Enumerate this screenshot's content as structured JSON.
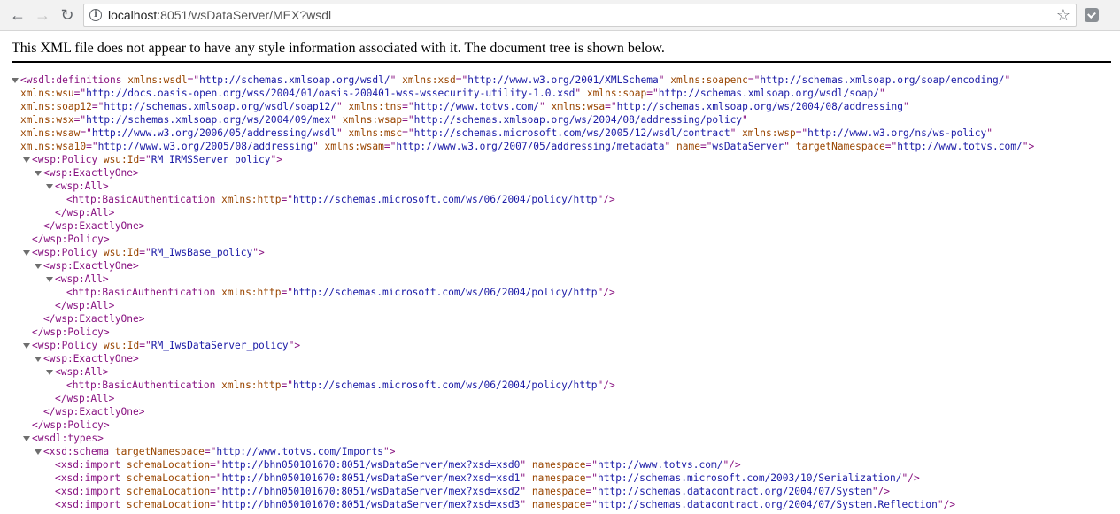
{
  "browser": {
    "url_host": "localhost",
    "url_rest": ":8051/wsDataServer/MEX?wsdl"
  },
  "info_banner": "This XML file does not appear to have any style information associated with it. The document tree is shown below.",
  "xml_lines": [
    {
      "indent": 0,
      "toggle": true,
      "parts": [
        [
          "t",
          "<wsdl:definitions "
        ],
        [
          "a",
          "xmlns:wsdl"
        ],
        [
          "t",
          "=\""
        ],
        [
          "v",
          "http://schemas.xmlsoap.org/wsdl/"
        ],
        [
          "t",
          "\" "
        ],
        [
          "a",
          "xmlns:xsd"
        ],
        [
          "t",
          "=\""
        ],
        [
          "v",
          "http://www.w3.org/2001/XMLSchema"
        ],
        [
          "t",
          "\" "
        ],
        [
          "a",
          "xmlns:soapenc"
        ],
        [
          "t",
          "=\""
        ],
        [
          "v",
          "http://schemas.xmlsoap.org/soap/encoding/"
        ],
        [
          "t",
          "\""
        ]
      ]
    },
    {
      "indent": 0,
      "toggle": false,
      "parts": [
        [
          "a",
          "xmlns:wsu"
        ],
        [
          "t",
          "=\""
        ],
        [
          "v",
          "http://docs.oasis-open.org/wss/2004/01/oasis-200401-wss-wssecurity-utility-1.0.xsd"
        ],
        [
          "t",
          "\" "
        ],
        [
          "a",
          "xmlns:soap"
        ],
        [
          "t",
          "=\""
        ],
        [
          "v",
          "http://schemas.xmlsoap.org/wsdl/soap/"
        ],
        [
          "t",
          "\""
        ]
      ]
    },
    {
      "indent": 0,
      "toggle": false,
      "parts": [
        [
          "a",
          "xmlns:soap12"
        ],
        [
          "t",
          "=\""
        ],
        [
          "v",
          "http://schemas.xmlsoap.org/wsdl/soap12/"
        ],
        [
          "t",
          "\" "
        ],
        [
          "a",
          "xmlns:tns"
        ],
        [
          "t",
          "=\""
        ],
        [
          "v",
          "http://www.totvs.com/"
        ],
        [
          "t",
          "\" "
        ],
        [
          "a",
          "xmlns:wsa"
        ],
        [
          "t",
          "=\""
        ],
        [
          "v",
          "http://schemas.xmlsoap.org/ws/2004/08/addressing"
        ],
        [
          "t",
          "\""
        ]
      ]
    },
    {
      "indent": 0,
      "toggle": false,
      "parts": [
        [
          "a",
          "xmlns:wsx"
        ],
        [
          "t",
          "=\""
        ],
        [
          "v",
          "http://schemas.xmlsoap.org/ws/2004/09/mex"
        ],
        [
          "t",
          "\" "
        ],
        [
          "a",
          "xmlns:wsap"
        ],
        [
          "t",
          "=\""
        ],
        [
          "v",
          "http://schemas.xmlsoap.org/ws/2004/08/addressing/policy"
        ],
        [
          "t",
          "\""
        ]
      ]
    },
    {
      "indent": 0,
      "toggle": false,
      "parts": [
        [
          "a",
          "xmlns:wsaw"
        ],
        [
          "t",
          "=\""
        ],
        [
          "v",
          "http://www.w3.org/2006/05/addressing/wsdl"
        ],
        [
          "t",
          "\" "
        ],
        [
          "a",
          "xmlns:msc"
        ],
        [
          "t",
          "=\""
        ],
        [
          "v",
          "http://schemas.microsoft.com/ws/2005/12/wsdl/contract"
        ],
        [
          "t",
          "\" "
        ],
        [
          "a",
          "xmlns:wsp"
        ],
        [
          "t",
          "=\""
        ],
        [
          "v",
          "http://www.w3.org/ns/ws-policy"
        ],
        [
          "t",
          "\""
        ]
      ]
    },
    {
      "indent": 0,
      "toggle": false,
      "parts": [
        [
          "a",
          "xmlns:wsa10"
        ],
        [
          "t",
          "=\""
        ],
        [
          "v",
          "http://www.w3.org/2005/08/addressing"
        ],
        [
          "t",
          "\" "
        ],
        [
          "a",
          "xmlns:wsam"
        ],
        [
          "t",
          "=\""
        ],
        [
          "v",
          "http://www.w3.org/2007/05/addressing/metadata"
        ],
        [
          "t",
          "\" "
        ],
        [
          "a",
          "name"
        ],
        [
          "t",
          "=\""
        ],
        [
          "v",
          "wsDataServer"
        ],
        [
          "t",
          "\" "
        ],
        [
          "a",
          "targetNamespace"
        ],
        [
          "t",
          "=\""
        ],
        [
          "v",
          "http://www.totvs.com/"
        ],
        [
          "t",
          "\">"
        ]
      ]
    },
    {
      "indent": 1,
      "toggle": true,
      "parts": [
        [
          "t",
          "<wsp:Policy "
        ],
        [
          "a",
          "wsu:Id"
        ],
        [
          "t",
          "=\""
        ],
        [
          "v",
          "RM_IRMSServer_policy"
        ],
        [
          "t",
          "\">"
        ]
      ]
    },
    {
      "indent": 2,
      "toggle": true,
      "parts": [
        [
          "t",
          "<wsp:ExactlyOne>"
        ]
      ]
    },
    {
      "indent": 3,
      "toggle": true,
      "parts": [
        [
          "t",
          "<wsp:All>"
        ]
      ]
    },
    {
      "indent": 4,
      "toggle": false,
      "parts": [
        [
          "t",
          "<http:BasicAuthentication "
        ],
        [
          "a",
          "xmlns:http"
        ],
        [
          "t",
          "=\""
        ],
        [
          "v",
          "http://schemas.microsoft.com/ws/06/2004/policy/http"
        ],
        [
          "t",
          "\"/>"
        ]
      ]
    },
    {
      "indent": 3,
      "toggle": false,
      "parts": [
        [
          "t",
          "</wsp:All>"
        ]
      ]
    },
    {
      "indent": 2,
      "toggle": false,
      "parts": [
        [
          "t",
          "</wsp:ExactlyOne>"
        ]
      ]
    },
    {
      "indent": 1,
      "toggle": false,
      "parts": [
        [
          "t",
          "</wsp:Policy>"
        ]
      ]
    },
    {
      "indent": 1,
      "toggle": true,
      "parts": [
        [
          "t",
          "<wsp:Policy "
        ],
        [
          "a",
          "wsu:Id"
        ],
        [
          "t",
          "=\""
        ],
        [
          "v",
          "RM_IwsBase_policy"
        ],
        [
          "t",
          "\">"
        ]
      ]
    },
    {
      "indent": 2,
      "toggle": true,
      "parts": [
        [
          "t",
          "<wsp:ExactlyOne>"
        ]
      ]
    },
    {
      "indent": 3,
      "toggle": true,
      "parts": [
        [
          "t",
          "<wsp:All>"
        ]
      ]
    },
    {
      "indent": 4,
      "toggle": false,
      "parts": [
        [
          "t",
          "<http:BasicAuthentication "
        ],
        [
          "a",
          "xmlns:http"
        ],
        [
          "t",
          "=\""
        ],
        [
          "v",
          "http://schemas.microsoft.com/ws/06/2004/policy/http"
        ],
        [
          "t",
          "\"/>"
        ]
      ]
    },
    {
      "indent": 3,
      "toggle": false,
      "parts": [
        [
          "t",
          "</wsp:All>"
        ]
      ]
    },
    {
      "indent": 2,
      "toggle": false,
      "parts": [
        [
          "t",
          "</wsp:ExactlyOne>"
        ]
      ]
    },
    {
      "indent": 1,
      "toggle": false,
      "parts": [
        [
          "t",
          "</wsp:Policy>"
        ]
      ]
    },
    {
      "indent": 1,
      "toggle": true,
      "parts": [
        [
          "t",
          "<wsp:Policy "
        ],
        [
          "a",
          "wsu:Id"
        ],
        [
          "t",
          "=\""
        ],
        [
          "v",
          "RM_IwsDataServer_policy"
        ],
        [
          "t",
          "\">"
        ]
      ]
    },
    {
      "indent": 2,
      "toggle": true,
      "parts": [
        [
          "t",
          "<wsp:ExactlyOne>"
        ]
      ]
    },
    {
      "indent": 3,
      "toggle": true,
      "parts": [
        [
          "t",
          "<wsp:All>"
        ]
      ]
    },
    {
      "indent": 4,
      "toggle": false,
      "parts": [
        [
          "t",
          "<http:BasicAuthentication "
        ],
        [
          "a",
          "xmlns:http"
        ],
        [
          "t",
          "=\""
        ],
        [
          "v",
          "http://schemas.microsoft.com/ws/06/2004/policy/http"
        ],
        [
          "t",
          "\"/>"
        ]
      ]
    },
    {
      "indent": 3,
      "toggle": false,
      "parts": [
        [
          "t",
          "</wsp:All>"
        ]
      ]
    },
    {
      "indent": 2,
      "toggle": false,
      "parts": [
        [
          "t",
          "</wsp:ExactlyOne>"
        ]
      ]
    },
    {
      "indent": 1,
      "toggle": false,
      "parts": [
        [
          "t",
          "</wsp:Policy>"
        ]
      ]
    },
    {
      "indent": 1,
      "toggle": true,
      "parts": [
        [
          "t",
          "<wsdl:types>"
        ]
      ]
    },
    {
      "indent": 2,
      "toggle": true,
      "parts": [
        [
          "t",
          "<xsd:schema "
        ],
        [
          "a",
          "targetNamespace"
        ],
        [
          "t",
          "=\""
        ],
        [
          "v",
          "http://www.totvs.com/Imports"
        ],
        [
          "t",
          "\">"
        ]
      ]
    },
    {
      "indent": 3,
      "toggle": false,
      "parts": [
        [
          "t",
          "<xsd:import "
        ],
        [
          "a",
          "schemaLocation"
        ],
        [
          "t",
          "=\""
        ],
        [
          "v",
          "http://bhn050101670:8051/wsDataServer/mex?xsd=xsd0"
        ],
        [
          "t",
          "\" "
        ],
        [
          "a",
          "namespace"
        ],
        [
          "t",
          "=\""
        ],
        [
          "v",
          "http://www.totvs.com/"
        ],
        [
          "t",
          "\"/>"
        ]
      ]
    },
    {
      "indent": 3,
      "toggle": false,
      "parts": [
        [
          "t",
          "<xsd:import "
        ],
        [
          "a",
          "schemaLocation"
        ],
        [
          "t",
          "=\""
        ],
        [
          "v",
          "http://bhn050101670:8051/wsDataServer/mex?xsd=xsd1"
        ],
        [
          "t",
          "\" "
        ],
        [
          "a",
          "namespace"
        ],
        [
          "t",
          "=\""
        ],
        [
          "v",
          "http://schemas.microsoft.com/2003/10/Serialization/"
        ],
        [
          "t",
          "\"/>"
        ]
      ]
    },
    {
      "indent": 3,
      "toggle": false,
      "parts": [
        [
          "t",
          "<xsd:import "
        ],
        [
          "a",
          "schemaLocation"
        ],
        [
          "t",
          "=\""
        ],
        [
          "v",
          "http://bhn050101670:8051/wsDataServer/mex?xsd=xsd2"
        ],
        [
          "t",
          "\" "
        ],
        [
          "a",
          "namespace"
        ],
        [
          "t",
          "=\""
        ],
        [
          "v",
          "http://schemas.datacontract.org/2004/07/System"
        ],
        [
          "t",
          "\"/>"
        ]
      ]
    },
    {
      "indent": 3,
      "toggle": false,
      "parts": [
        [
          "t",
          "<xsd:import "
        ],
        [
          "a",
          "schemaLocation"
        ],
        [
          "t",
          "=\""
        ],
        [
          "v",
          "http://bhn050101670:8051/wsDataServer/mex?xsd=xsd3"
        ],
        [
          "t",
          "\" "
        ],
        [
          "a",
          "namespace"
        ],
        [
          "t",
          "=\""
        ],
        [
          "v",
          "http://schemas.datacontract.org/2004/07/System.Reflection"
        ],
        [
          "t",
          "\"/>"
        ]
      ]
    }
  ]
}
